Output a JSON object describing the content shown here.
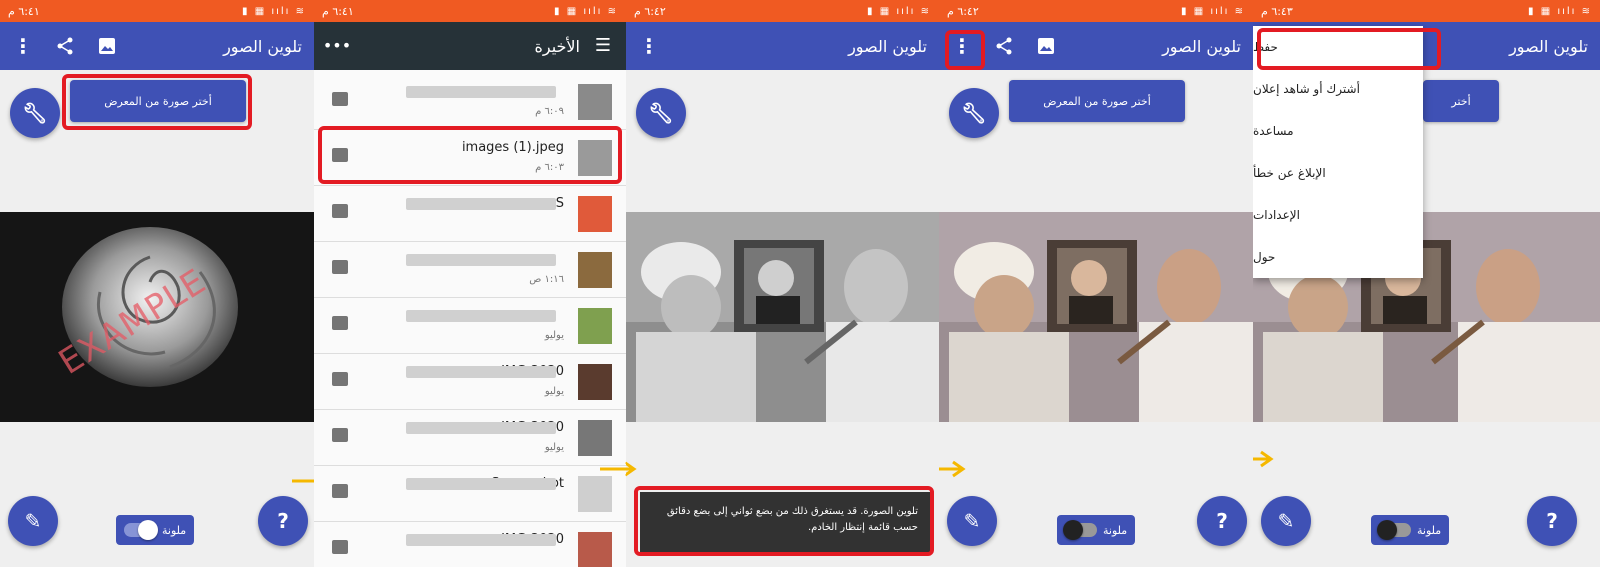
{
  "status_bar": {
    "p1_time": "٦:٤١ م",
    "p2_time": "٦:٤١ م",
    "p3_time": "٦:٤٢ م",
    "p4_time": "٦:٤٢ م",
    "p5_time": "٦:٤٣ م",
    "icons": "▮ ▦ ıılı ≋"
  },
  "app": {
    "title": "تلوين الصور",
    "pick_button": "أختر صورة من المعرض",
    "toggle_label": "ملونة",
    "help_label": "?"
  },
  "picker": {
    "title": "الأخيرة",
    "files": [
      {
        "name": "",
        "sub": "٦:٠٩ م",
        "thumb": "#8a8a8a"
      },
      {
        "name": "images (1).jpeg",
        "sub": "٦:٠٣ م",
        "thumb": "#9a9a9a"
      },
      {
        "name": "S",
        "sub": "",
        "thumb": "#e05a3a"
      },
      {
        "name": "",
        "sub": "١:١٦ ص",
        "thumb": "#8b6a3e"
      },
      {
        "name": "",
        "sub": "يوليو",
        "thumb": "#7fa04f"
      },
      {
        "name": "IMG-2020",
        "sub": "يوليو",
        "thumb": "#5a3b2e"
      },
      {
        "name": "IMG-2020",
        "sub": "يوليو",
        "thumb": "#777777"
      },
      {
        "name": "Screenshot",
        "sub": "",
        "thumb": "#cfcfcf"
      },
      {
        "name": "IMG-2020",
        "sub": "",
        "thumb": "#b85a4a"
      }
    ]
  },
  "toast": {
    "text": "تلوين الصورة. قد يستغرق ذلك من بضع ثواني إلى بضع دقائق حسب قائمة إنتظار الخادم."
  },
  "menu": {
    "items": [
      "حفظ",
      "أشترك أو شاهد إعلان",
      "مساعدة",
      "الإبلاغ عن خطأ",
      "الإعدادات",
      "حول"
    ]
  },
  "example_watermark": "EXAMPLE",
  "colors": {
    "accent": "#3f51b5",
    "status": "#f05a22",
    "highlight": "#e31b23",
    "arrow": "#f5b800"
  }
}
